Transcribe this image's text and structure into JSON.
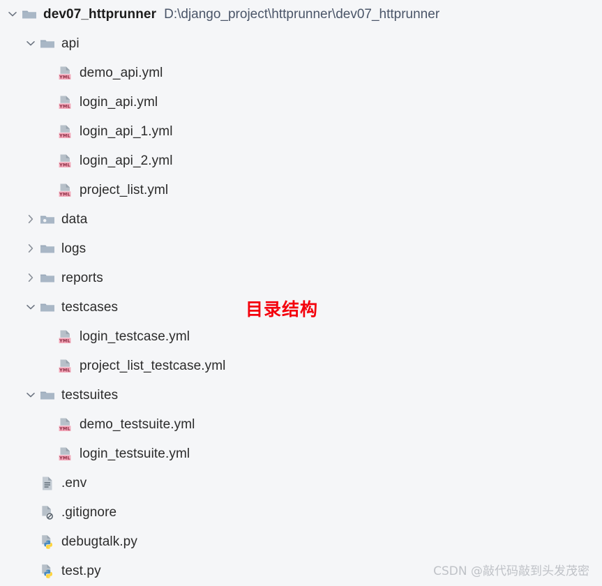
{
  "project": {
    "root_name": "dev07_httprunner",
    "root_path": "D:\\django_project\\httprunner\\dev07_httprunner"
  },
  "annotation": {
    "text": "目录结构",
    "color": "#f4000c"
  },
  "watermark": {
    "text": "CSDN @敲代码敲到头发茂密",
    "color": "#bfc2c7"
  },
  "colors": {
    "background": "#f5f6f8",
    "folder": "#a9b7c6",
    "file_doc": "#b0bac4",
    "yml_badge": "#f4a7b9",
    "python_blue": "#4b8bbe",
    "python_yellow": "#ffd43b",
    "text": "#2b2b2b",
    "path_text": "#4a5568"
  },
  "tree": [
    {
      "label": "dev07_httprunner",
      "type": "folder",
      "icon": "folder-icon",
      "level": 0,
      "state": "expanded",
      "bold": true,
      "path": "D:\\django_project\\httprunner\\dev07_httprunner"
    },
    {
      "label": "api",
      "type": "folder",
      "icon": "folder-icon",
      "level": 1,
      "state": "expanded"
    },
    {
      "label": "demo_api.yml",
      "type": "file",
      "icon": "yml-file-icon",
      "level": 2,
      "state": "none"
    },
    {
      "label": "login_api.yml",
      "type": "file",
      "icon": "yml-file-icon",
      "level": 2,
      "state": "none"
    },
    {
      "label": "login_api_1.yml",
      "type": "file",
      "icon": "yml-file-icon",
      "level": 2,
      "state": "none"
    },
    {
      "label": "login_api_2.yml",
      "type": "file",
      "icon": "yml-file-icon",
      "level": 2,
      "state": "none"
    },
    {
      "label": "project_list.yml",
      "type": "file",
      "icon": "yml-file-icon",
      "level": 2,
      "state": "none"
    },
    {
      "label": "data",
      "type": "folder",
      "icon": "folder-excluded-icon",
      "level": 1,
      "state": "collapsed"
    },
    {
      "label": "logs",
      "type": "folder",
      "icon": "folder-icon",
      "level": 1,
      "state": "collapsed"
    },
    {
      "label": "reports",
      "type": "folder",
      "icon": "folder-icon",
      "level": 1,
      "state": "collapsed"
    },
    {
      "label": "testcases",
      "type": "folder",
      "icon": "folder-icon",
      "level": 1,
      "state": "expanded"
    },
    {
      "label": "login_testcase.yml",
      "type": "file",
      "icon": "yml-file-icon",
      "level": 2,
      "state": "none"
    },
    {
      "label": "project_list_testcase.yml",
      "type": "file",
      "icon": "yml-file-icon",
      "level": 2,
      "state": "none"
    },
    {
      "label": "testsuites",
      "type": "folder",
      "icon": "folder-icon",
      "level": 1,
      "state": "expanded"
    },
    {
      "label": "demo_testsuite.yml",
      "type": "file",
      "icon": "yml-file-icon",
      "level": 2,
      "state": "none"
    },
    {
      "label": "login_testsuite.yml",
      "type": "file",
      "icon": "yml-file-icon",
      "level": 2,
      "state": "none"
    },
    {
      "label": ".env",
      "type": "file",
      "icon": "text-file-icon",
      "level": 1,
      "state": "none"
    },
    {
      "label": ".gitignore",
      "type": "file",
      "icon": "ignored-file-icon",
      "level": 1,
      "state": "none"
    },
    {
      "label": "debugtalk.py",
      "type": "file",
      "icon": "python-file-icon",
      "level": 1,
      "state": "none"
    },
    {
      "label": "test.py",
      "type": "file",
      "icon": "python-file-icon",
      "level": 1,
      "state": "none"
    }
  ]
}
